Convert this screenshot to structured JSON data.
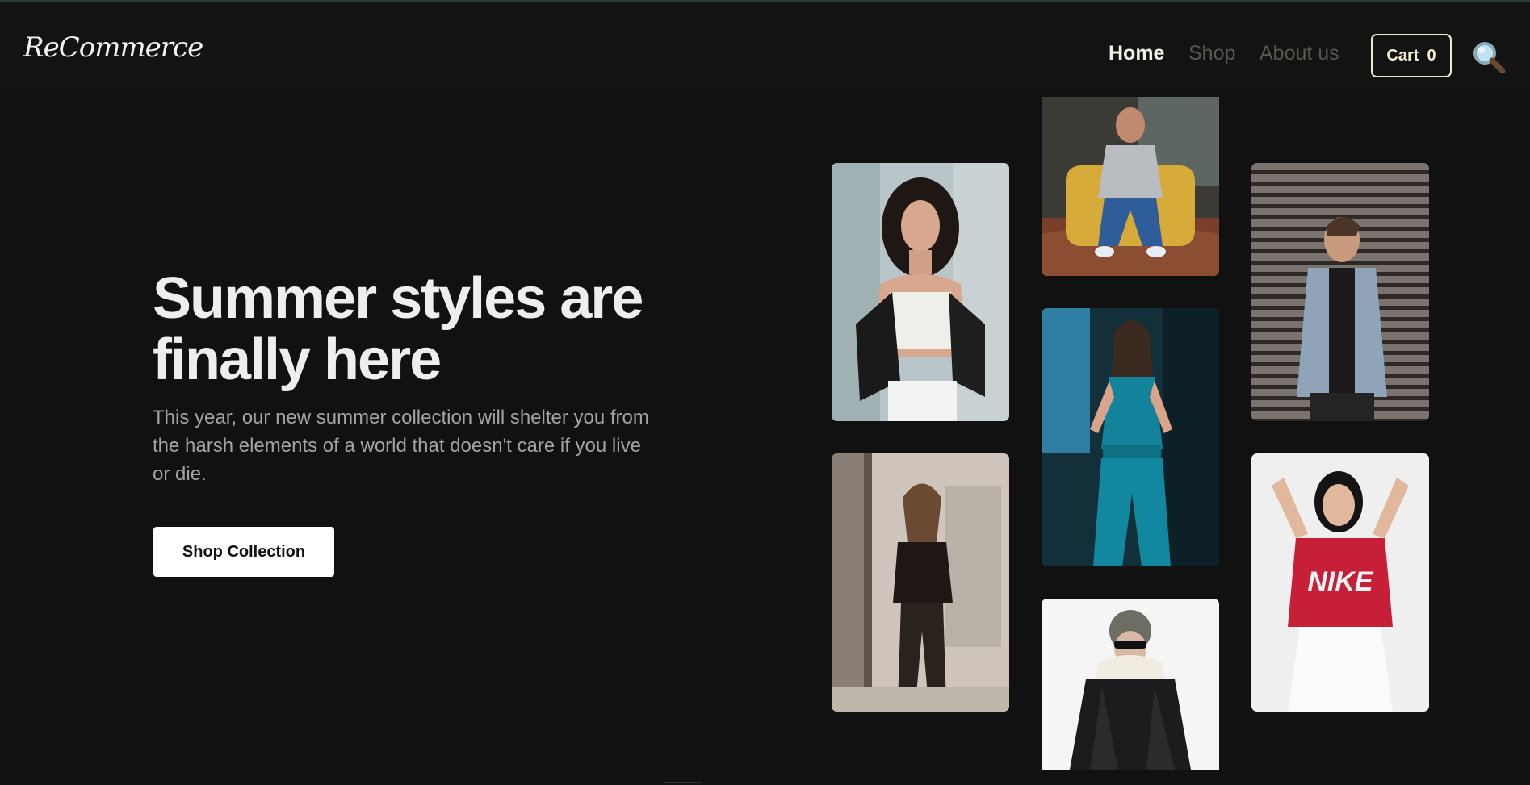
{
  "brand": {
    "logo_text": "ReCommerce"
  },
  "nav": {
    "links": [
      {
        "label": "Home",
        "active": true
      },
      {
        "label": "Shop",
        "active": false
      },
      {
        "label": "About us",
        "active": false
      }
    ],
    "cart_label": "Cart",
    "cart_count": "0",
    "search_icon": "magnifier-icon"
  },
  "hero": {
    "title": "Summer styles are finally here",
    "description": "This year, our new summer collection will shelter you from the harsh elements of a world that doesn't care if you live or die.",
    "cta_label": "Shop Collection"
  },
  "gallery": {
    "photos": [
      {
        "name": "woman-curly-hair-white-top"
      },
      {
        "name": "woman-black-outfit-window"
      },
      {
        "name": "man-yellow-chair"
      },
      {
        "name": "woman-teal-jumpsuit"
      },
      {
        "name": "woman-black-puffer-jacket"
      },
      {
        "name": "man-denim-jacket"
      },
      {
        "name": "woman-red-nike-tee"
      }
    ]
  },
  "colors": {
    "background": "#111111",
    "accent": "#efe7cf",
    "muted_link": "#5b554d"
  }
}
